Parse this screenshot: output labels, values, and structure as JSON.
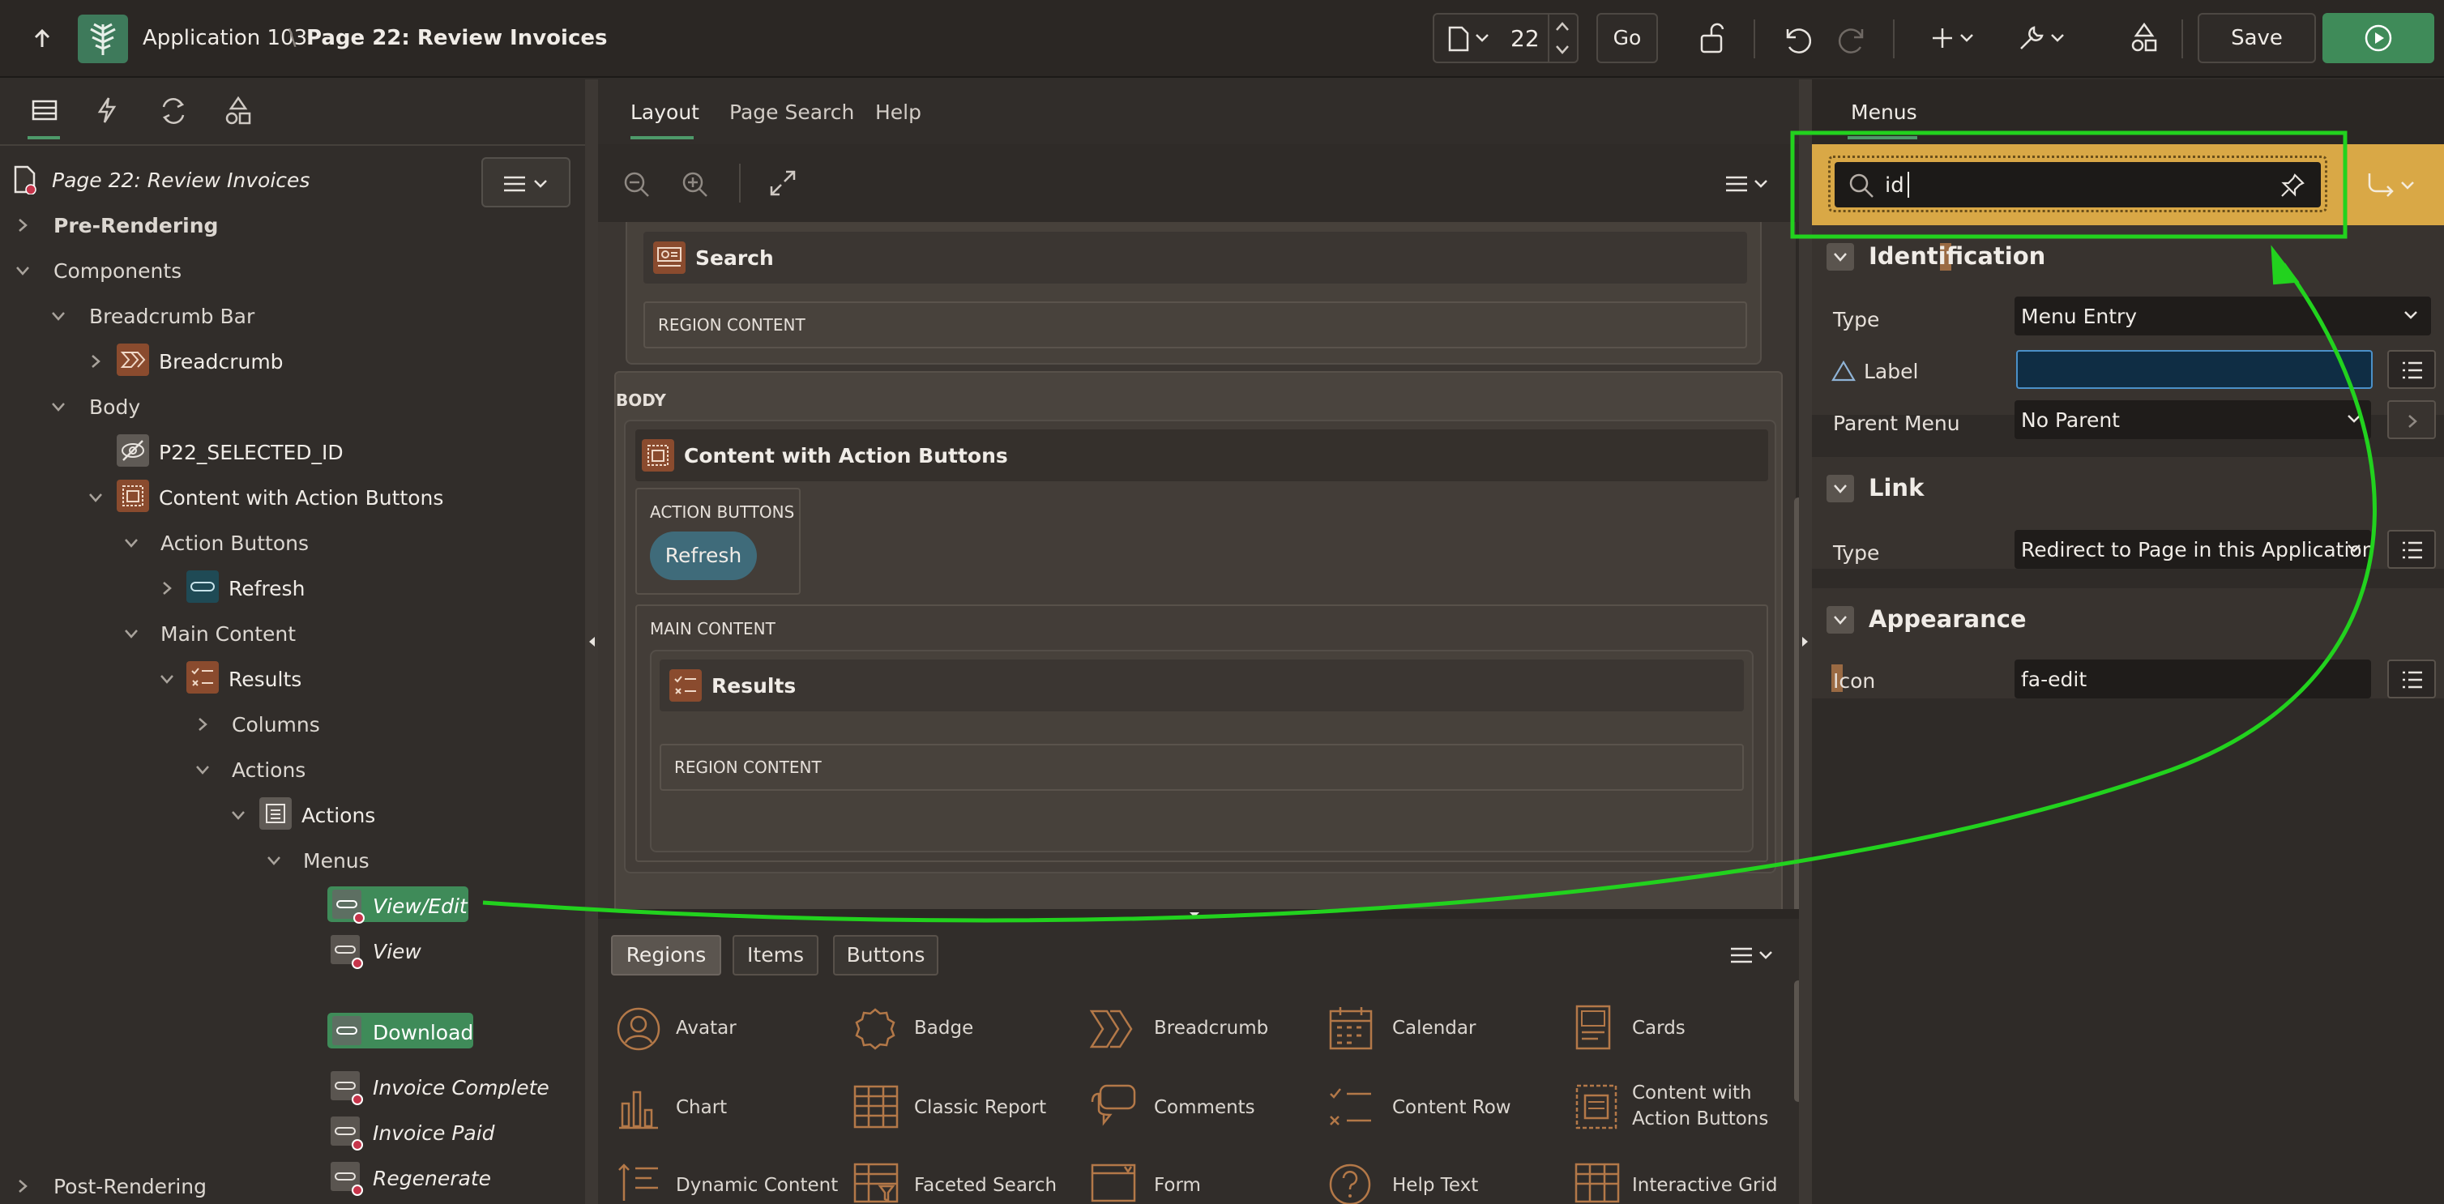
{
  "header": {
    "app_name": "Application 103",
    "separator": "\\",
    "page_title": "Page 22: Review Invoices",
    "page_number": "22",
    "go_label": "Go",
    "save_label": "Save"
  },
  "left": {
    "root": "Page 22: Review Invoices",
    "items": {
      "pre_rendering": "Pre-Rendering",
      "components": "Components",
      "breadcrumb_bar": "Breadcrumb Bar",
      "breadcrumb": "Breadcrumb",
      "body": "Body",
      "p22": "P22_SELECTED_ID",
      "content_action": "Content with Action Buttons",
      "action_buttons": "Action Buttons",
      "refresh": "Refresh",
      "main_content": "Main Content",
      "results": "Results",
      "columns": "Columns",
      "actions": "Actions",
      "actions2": "Actions",
      "menus": "Menus",
      "view_edit": "View/Edit",
      "view": "View",
      "download": "Download",
      "invoice_complete": "Invoice Complete",
      "invoice_paid": "Invoice Paid",
      "regenerate": "Regenerate",
      "post_rendering": "Post-Rendering"
    }
  },
  "middle": {
    "tabs": [
      "Layout",
      "Page Search",
      "Help"
    ],
    "search_region": "Search",
    "region_content": "REGION CONTENT",
    "body_label": "BODY",
    "content_action": "Content with Action Buttons",
    "action_buttons_label": "ACTION BUTTONS",
    "refresh_btn": "Refresh",
    "main_content_label": "MAIN CONTENT",
    "results": "Results",
    "region_content2": "REGION CONTENT",
    "gallery_tabs": [
      "Regions",
      "Items",
      "Buttons"
    ],
    "gallery": [
      "Avatar",
      "Badge",
      "Breadcrumb",
      "Calendar",
      "Cards",
      "Chart",
      "Classic Report",
      "Comments",
      "Content Row",
      "Content with",
      "Action Buttons",
      "Dynamic Content",
      "Faceted Search",
      "Form",
      "Help Text",
      "Interactive Grid"
    ]
  },
  "right": {
    "tab": "Menus",
    "filter_value": "id",
    "sections": {
      "identification": "Identification",
      "link": "Link",
      "appearance": "Appearance"
    },
    "props": {
      "type_label": "Type",
      "type_value": "Menu Entry",
      "label_label": "Label",
      "parent_label": "Parent Menu",
      "parent_value": "No Parent",
      "link_type_label": "Type",
      "link_type_value": "Redirect to Page in this Application",
      "icon_label": "Icon",
      "icon_value": "fa-edit"
    }
  },
  "colors": {
    "accent_green": "#3f8b59",
    "highlight_yellow": "#d9a846",
    "annotation_green": "#22d21e"
  }
}
